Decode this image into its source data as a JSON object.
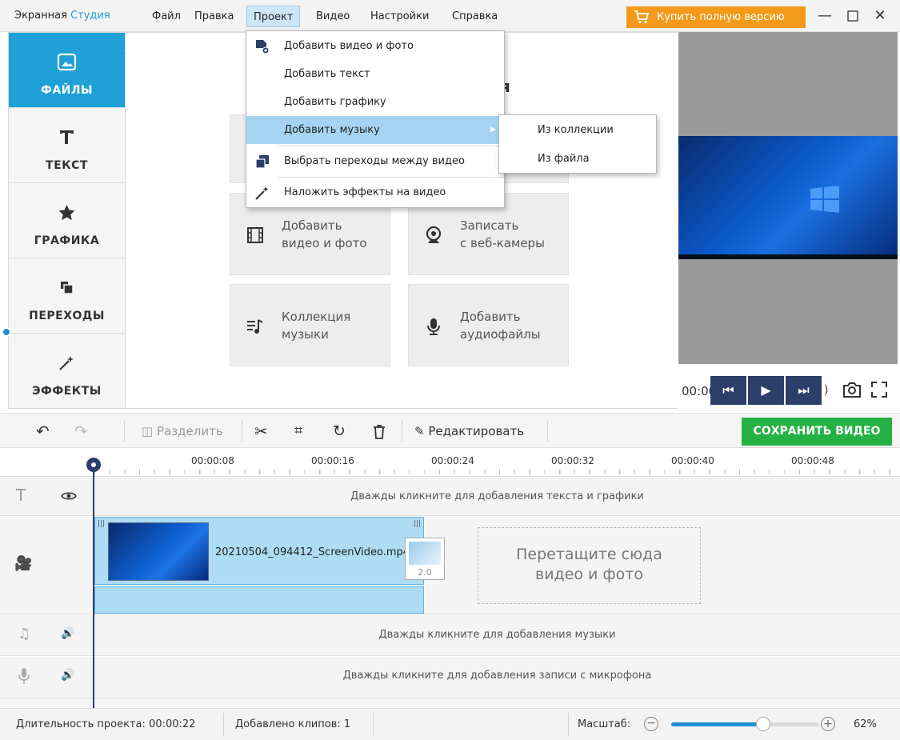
{
  "app": {
    "title_main": "Экранная",
    "title_accent": "Студия"
  },
  "menu": [
    "Файл",
    "Правка",
    "Проект",
    "Видео",
    "Настройки",
    "Справка"
  ],
  "buy_label": "Купить полную версию",
  "window_controls": [
    "minimize-icon",
    "maximize-icon",
    "close-icon"
  ],
  "sidebar": {
    "items": [
      {
        "label": "ФАЙЛЫ",
        "icon": "image-icon",
        "active": true
      },
      {
        "label": "ТЕКСТ",
        "icon": "text-icon"
      },
      {
        "label": "ГРАФИКА",
        "icon": "star-icon"
      },
      {
        "label": "ПЕРЕХОДЫ",
        "icon": "transitions-icon"
      },
      {
        "label": "ЭФФЕКТЫ",
        "icon": "magic-wand-icon"
      }
    ]
  },
  "main": {
    "heading_partial": "я",
    "buttons": [
      {
        "line1": "Добавить",
        "line2": "видео и фото",
        "icon": "film-icon"
      },
      {
        "line1": "Записать",
        "line2": "с веб-камеры",
        "icon": "webcam-icon"
      },
      {
        "line1": "Коллекция",
        "line2": "музыки",
        "icon": "music-list-icon"
      },
      {
        "line1": "Добавить",
        "line2": "аудиофайлы",
        "icon": "microphone-icon"
      }
    ]
  },
  "dropdown": {
    "items": [
      {
        "label": "Добавить видео и фото",
        "icon": "add-media-icon"
      },
      {
        "label": "Добавить текст"
      },
      {
        "label": "Добавить графику"
      },
      {
        "label": "Добавить музыку",
        "highlighted": true,
        "submenu": true
      },
      {
        "label": "Выбрать переходы между видео",
        "icon": "transitions-icon"
      },
      {
        "label": "Наложить эффекты на видео",
        "icon": "magic-wand-icon"
      }
    ],
    "submenu": [
      "Из коллекции",
      "Из файла"
    ]
  },
  "preview": {
    "time": "00:00"
  },
  "toolbar": {
    "split_label": "Разделить",
    "edit_label": "Редактировать",
    "save_label": "СОХРАНИТЬ ВИДЕО"
  },
  "ruler": [
    "00:00:08",
    "00:00:16",
    "00:00:24",
    "00:00:32",
    "00:00:40",
    "00:00:48"
  ],
  "tracks": {
    "text_hint": "Дважды кликните для добавления текста и графики",
    "music_hint": "Дважды кликните для добавления музыки",
    "mic_hint": "Дважды кликните для добавления записи с микрофона",
    "clip_name": "20210504_094412_ScreenVideo.mp4",
    "transition_duration": "2.0",
    "dropzone_line1": "Перетащите сюда",
    "dropzone_line2": "видео и фото"
  },
  "status": {
    "duration_label": "Длительность проекта:",
    "duration_value": "00:00:22",
    "clips_label": "Добавлено клипов:",
    "clips_value": "1",
    "zoom_label": "Масштаб:",
    "zoom_value": "62%",
    "zoom_fraction": 0.62
  },
  "colors": {
    "accent": "#1fa0d6",
    "buy": "#f39a1b",
    "save": "#26b144",
    "player": "#2c3e6a"
  }
}
